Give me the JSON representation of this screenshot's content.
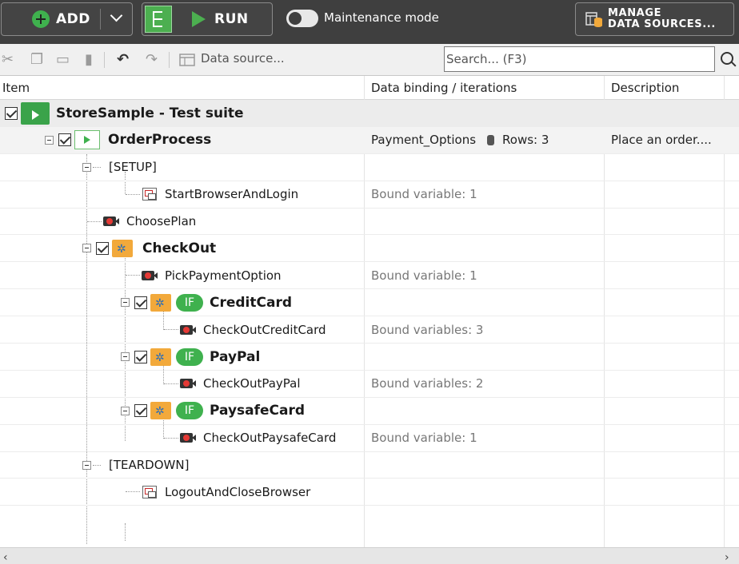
{
  "topbar": {
    "add_label": "ADD",
    "run_label": "RUN",
    "maintenance_label": "Maintenance mode",
    "maintenance_on": false,
    "manage_line1": "MANAGE",
    "manage_line2": "DATA SOURCES..."
  },
  "toolbar": {
    "data_source_label": "Data source...",
    "search_placeholder": "Search... (F3)"
  },
  "columns": {
    "item": "Item",
    "binding": "Data binding / iterations",
    "description": "Description"
  },
  "rows": [
    {
      "name": "StoreSample - Test suite",
      "binding": "",
      "description": ""
    },
    {
      "name": "OrderProcess",
      "binding": "Payment_Options",
      "rows_label": "Rows: 3",
      "description": "Place an order...."
    },
    {
      "name": "[SETUP]",
      "binding": "",
      "description": ""
    },
    {
      "name": "StartBrowserAndLogin",
      "binding": "Bound variable: 1",
      "description": ""
    },
    {
      "name": "ChoosePlan",
      "binding": "",
      "description": ""
    },
    {
      "name": "CheckOut",
      "binding": "",
      "description": ""
    },
    {
      "name": "PickPaymentOption",
      "binding": "Bound variable: 1",
      "description": ""
    },
    {
      "name": "CreditCard",
      "if_label": "IF",
      "binding": "",
      "description": ""
    },
    {
      "name": "CheckOutCreditCard",
      "binding": "Bound variables: 3",
      "description": ""
    },
    {
      "name": "PayPal",
      "if_label": "IF",
      "binding": "",
      "description": ""
    },
    {
      "name": "CheckOutPayPal",
      "binding": "Bound variables: 2",
      "description": ""
    },
    {
      "name": "PaysafeCard",
      "if_label": "IF",
      "binding": "",
      "description": ""
    },
    {
      "name": "CheckOutPaysafeCard",
      "binding": "Bound variable: 1",
      "description": ""
    },
    {
      "name": "[TEARDOWN]",
      "binding": "",
      "description": ""
    },
    {
      "name": "LogoutAndCloseBrowser",
      "binding": "",
      "description": ""
    }
  ],
  "icons": {
    "cut": "cut-icon",
    "copy": "copy-icon",
    "paste": "paste-icon",
    "delete": "delete-icon",
    "undo": "undo-icon",
    "redo": "redo-icon",
    "search": "search-icon",
    "datasource": "data-source-icon"
  },
  "colors": {
    "accent_green": "#3fb14e",
    "topbar_bg": "#3f3f3f",
    "folder_orange": "#f2a93b"
  }
}
